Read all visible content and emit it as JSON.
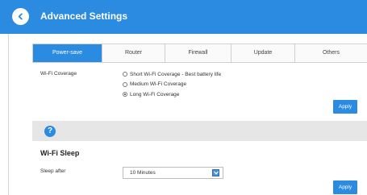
{
  "header": {
    "title": "Advanced Settings",
    "back_icon": "chevron-left-icon"
  },
  "tabs": [
    {
      "label": "Power-save",
      "active": true
    },
    {
      "label": "Router",
      "active": false
    },
    {
      "label": "Firewall",
      "active": false
    },
    {
      "label": "Update",
      "active": false
    },
    {
      "label": "Others",
      "active": false
    }
  ],
  "wifi_coverage": {
    "label": "Wi-Fi Coverage",
    "options": [
      {
        "label": "Short Wi-Fi Coverage - Best battery life",
        "checked": false
      },
      {
        "label": "Medium Wi-Fi Coverage",
        "checked": false
      },
      {
        "label": "Long Wi-Fi Coverage",
        "checked": true
      }
    ],
    "apply_label": "Apply"
  },
  "help": {
    "icon": "help-icon",
    "symbol": "?"
  },
  "wifi_sleep": {
    "title": "Wi-Fi Sleep",
    "sleep_label": "Sleep after",
    "sleep_value": "10 Minutes",
    "apply_label": "Apply"
  },
  "colors": {
    "accent": "#2a8be0",
    "band": "#e6e6e6"
  }
}
